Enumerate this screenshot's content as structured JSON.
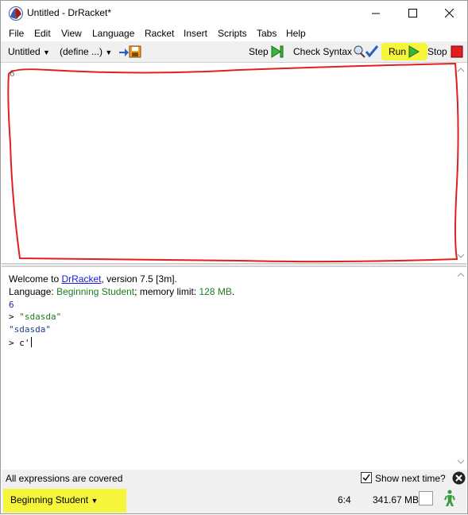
{
  "window": {
    "title": "Untitled - DrRacket*"
  },
  "menu": [
    "File",
    "Edit",
    "View",
    "Language",
    "Racket",
    "Insert",
    "Scripts",
    "Tabs",
    "Help"
  ],
  "toolbar": {
    "file_menu": "Untitled",
    "define_menu": "(define ...)",
    "step_label": "Step",
    "check_syntax_label": "Check Syntax",
    "run_label": "Run",
    "stop_label": "Stop"
  },
  "definitions": {
    "content": "6"
  },
  "interactions": {
    "welcome_prefix": "Welcome to ",
    "welcome_link": "DrRacket",
    "welcome_suffix": ", version 7.5 [3m].",
    "language_prefix": "Language: ",
    "language_name": "Beginning Student",
    "memory_prefix": "; memory limit: ",
    "memory_limit": "128 MB",
    "memory_suffix": ".",
    "output_1": "6",
    "prompt_1": "> ",
    "input_1": "\"sdasda\"",
    "output_2": "\"sdasda\"",
    "prompt_2": "> ",
    "input_2": "c'"
  },
  "status": {
    "coverage": "All expressions are covered",
    "show_next_time": "Show next time?",
    "show_next_time_checked": true,
    "language": "Beginning Student",
    "position": "6:4",
    "memory": "341.67 MB"
  },
  "colors": {
    "annotation_red": "#e01f1f",
    "annotation_yellow": "#f5f53c",
    "run_green": "#3cb43c",
    "stop_red": "#e02020"
  }
}
